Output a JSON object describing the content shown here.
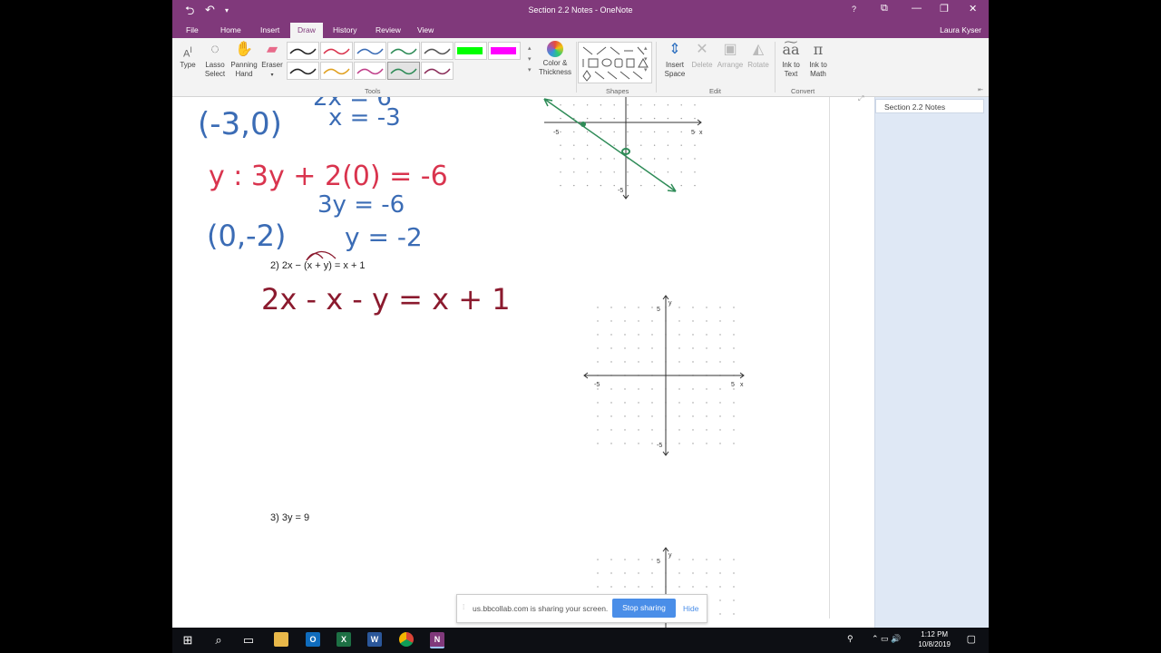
{
  "window": {
    "title": "Section 2.2 Notes - OneNote",
    "user": "Laura Kyser",
    "help": "?",
    "controls": {
      "ribbon_display": "⧉",
      "minimize": "—",
      "restore": "❐",
      "close": "✕"
    },
    "quick_access": {
      "back": "⮌",
      "undo": "↶",
      "customize": "▾"
    }
  },
  "tabs": [
    "File",
    "Home",
    "Insert",
    "Draw",
    "History",
    "Review",
    "View"
  ],
  "active_tab": "Draw",
  "ribbon": {
    "tools": {
      "type": "Type",
      "lasso": [
        "Lasso",
        "Select"
      ],
      "panning": [
        "Panning",
        "Hand"
      ],
      "eraser": "Eraser",
      "color_thickness": [
        "Color &",
        "Thickness"
      ],
      "group_label": "Tools"
    },
    "pens": [
      {
        "color": "#222222"
      },
      {
        "color": "#d9344e"
      },
      {
        "color": "#3b6cb5"
      },
      {
        "color": "#2e8b57"
      },
      {
        "color": "#555555"
      },
      {
        "color": "#00ff00"
      },
      {
        "color": "#ff00ff"
      },
      {
        "color": "#222222"
      },
      {
        "color": "#e0a020"
      },
      {
        "color": "#c0408a"
      },
      {
        "color": "#2e8b57"
      },
      {
        "color": "#8b2e5a"
      }
    ],
    "shapes_label": "Shapes",
    "edit": {
      "insert_space": [
        "Insert",
        "Space"
      ],
      "delete": "Delete",
      "arrange": "Arrange",
      "rotate": "Rotate",
      "group_label": "Edit"
    },
    "convert": {
      "ink_to_text": [
        "Ink to",
        "Text"
      ],
      "ink_to_math": [
        "Ink to",
        "Math"
      ],
      "group_label": "Convert"
    }
  },
  "page": {
    "problem2": "2)  2x − (x + y) = x + 1",
    "problem3": "3)  3y = 9",
    "ink": {
      "blue_top_right": "x = -3",
      "blue_point_1": "(-3,0)",
      "red_line_1": "y : 3y + 2(0) = -6",
      "blue_line_2": "3y = -6",
      "blue_point_2": "(0,-2)",
      "blue_line_3": "y = -2",
      "red_eq_2": "2x - x - y = x + 1"
    },
    "graph_labels": {
      "neg5": "-5",
      "pos5": "5",
      "x": "x",
      "y": "y"
    }
  },
  "nav": {
    "page_tab": "Section 2.2 Notes"
  },
  "share": {
    "text": "us.bbcollab.com is sharing your screen.",
    "stop": "Stop sharing",
    "hide": "Hide"
  },
  "taskbar": {
    "time": "1:12 PM",
    "date": "10/8/2019",
    "apps": [
      "Outlook",
      "Excel",
      "Word",
      "Chrome",
      "OneNote"
    ],
    "app_letters": [
      "O",
      "X",
      "W",
      "",
      "N"
    ],
    "tray": "⌃  ▭  🔊"
  }
}
